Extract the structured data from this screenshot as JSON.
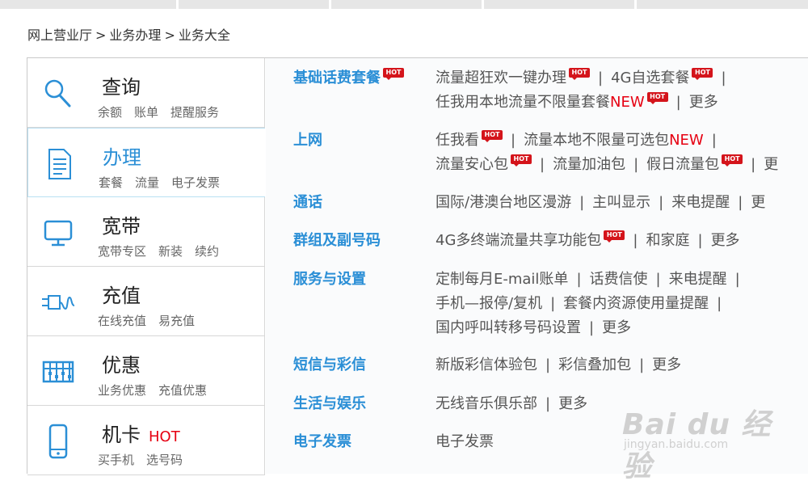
{
  "breadcrumb": {
    "items": [
      "网上营业厅",
      "业务办理",
      "业务大全"
    ],
    "separator": ">"
  },
  "categories": [
    {
      "title": "查询",
      "links": [
        "余额",
        "账单",
        "提醒服务"
      ],
      "icon": "magnifier-icon"
    },
    {
      "title": "办理",
      "links": [
        "套餐",
        "流量",
        "电子发票"
      ],
      "icon": "document-icon",
      "active": true
    },
    {
      "title": "宽带",
      "links": [
        "宽带专区",
        "新装",
        "续约"
      ],
      "icon": "monitor-icon"
    },
    {
      "title": "充值",
      "links": [
        "在线充值",
        "易充值"
      ],
      "icon": "plug-icon"
    },
    {
      "title": "优惠",
      "links": [
        "业务优惠",
        "充值优惠"
      ],
      "icon": "abacus-icon"
    },
    {
      "title": "机卡",
      "badge": "HOT",
      "links": [
        "买手机",
        "选号码"
      ],
      "icon": "phone-icon"
    }
  ],
  "hot_badge": "HOT",
  "services": [
    {
      "title": "基础话费套餐",
      "lines": [
        "流量超狂欢一键办理",
        "4G自选套餐",
        "任我用本地流量不限量套餐",
        "NEW",
        "更多"
      ]
    },
    {
      "title": "上网",
      "lines": [
        "任我看",
        "流量本地不限量可选包",
        "NEW",
        "流量安心包",
        "流量加油包",
        "假日流量包",
        "更"
      ]
    },
    {
      "title": "通话",
      "lines": [
        "国际/港澳台地区漫游",
        "主叫显示",
        "来电提醒",
        "更"
      ]
    },
    {
      "title": "群组及副号码",
      "lines": [
        "4G多终端流量共享功能包",
        "和家庭",
        "更多"
      ]
    },
    {
      "title": "服务与设置",
      "lines": [
        "定制每月E-mail账单",
        "话费信使",
        "来电提醒",
        "手机—报停/复机",
        "套餐内资源使用量提醒",
        "国内呼叫转移号码设置",
        "更多"
      ]
    },
    {
      "title": "短信与彩信",
      "lines": [
        "新版彩信体验包",
        "彩信叠加包",
        "更多"
      ]
    },
    {
      "title": "生活与娱乐",
      "lines": [
        "无线音乐俱乐部",
        "更多"
      ]
    },
    {
      "title": "电子发票",
      "lines": [
        "电子发票"
      ]
    }
  ],
  "watermark": {
    "logo": "Bai du 经验",
    "url": "jingyan.baidu.com"
  }
}
